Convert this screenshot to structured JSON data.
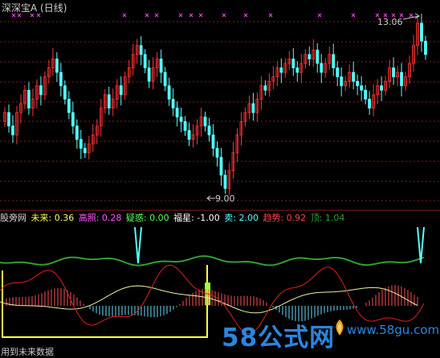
{
  "header": {
    "title": "深深宝A (日线)",
    "high_label": "13.06",
    "low_label": "9.00"
  },
  "indicator": {
    "items": [
      {
        "label": "股旁网",
        "color": "#d8d8d8"
      },
      {
        "label": "未来: 0.36",
        "color": "#ffff55"
      },
      {
        "label": "高照: 0.28",
        "color": "#ff55ff"
      },
      {
        "label": "疑惑: 0.00",
        "color": "#55ff55"
      },
      {
        "label": "福星: -1.00",
        "color": "#ffffff"
      },
      {
        "label": "卖: 2.00",
        "color": "#55ffff"
      },
      {
        "label": "趋势: 0.92",
        "color": "#ff4444"
      },
      {
        "label": "顶: 1.04",
        "color": "#2e9e2e"
      }
    ]
  },
  "watermark": {
    "text": "58公式网",
    "url": "www.58gu.com"
  },
  "footer": {
    "text": "用到未来数据"
  },
  "colors": {
    "up": "#ff3333",
    "down": "#55ffff",
    "grid": "#8b1a1a",
    "trend": "#e02020",
    "future": "#f0f0a0",
    "top": "#30a030"
  },
  "chart_data": {
    "type": "candlestick",
    "title": "深深宝A (日线)",
    "high_marker": 13.06,
    "low_marker": 9.0
  }
}
